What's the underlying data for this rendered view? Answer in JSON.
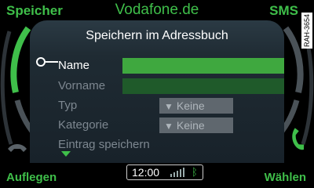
{
  "top_left": "Speicher",
  "top_center": "Vodafone.de",
  "top_right": "SMS",
  "bottom_left": "Auflegen",
  "bottom_right": "Wählen",
  "code": "RAH-3654",
  "panel": {
    "title": "Speichern im Adressbuch",
    "rows": [
      {
        "label": "Name"
      },
      {
        "label": "Vorname"
      },
      {
        "label": "Typ",
        "value": "Keine"
      },
      {
        "label": "Kategorie",
        "value": "Keine"
      },
      {
        "label": "Eintrag speichern"
      }
    ]
  },
  "status": {
    "time": "12:00",
    "bluetooth": "ᛒ"
  },
  "colors": {
    "accent": "#3fbf4a",
    "field_active": "#3fa83f",
    "field_inactive": "#1f5a2a"
  }
}
